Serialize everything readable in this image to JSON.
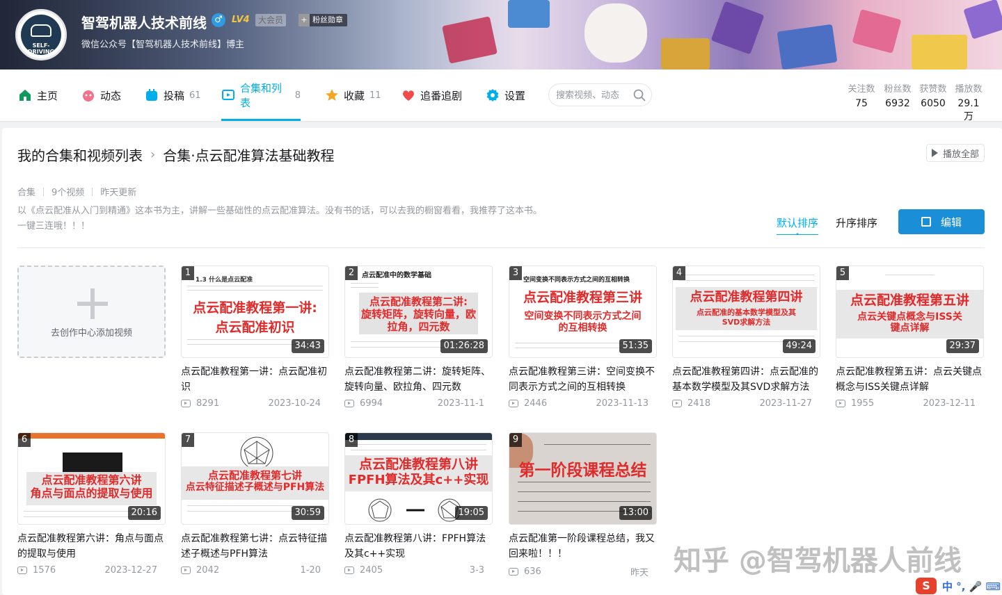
{
  "profile": {
    "name": "智驾机器人技术前线",
    "gender_symbol": "♂",
    "level": "LV4",
    "vip": "大会员",
    "fans_badge": "粉丝勋章",
    "fans_badge_plus": "+",
    "sign": "微信公众号【智驾机器人技术前线】博主",
    "avatar_text": "SELF-DRIVING ROBOT"
  },
  "nav": {
    "items": [
      {
        "label": "主页",
        "count": "",
        "icon": "home-icon",
        "color": "#0e9a5a"
      },
      {
        "label": "动态",
        "count": "",
        "icon": "dynamic-icon",
        "color": "#f2728b"
      },
      {
        "label": "投稿",
        "count": "61",
        "icon": "upload-icon",
        "color": "#00aeec"
      },
      {
        "label": "合集和列表",
        "count": "8",
        "icon": "collection-icon",
        "color": "#00aeec",
        "active": true
      },
      {
        "label": "收藏",
        "count": "11",
        "icon": "star-icon",
        "color": "#f5a623"
      },
      {
        "label": "追番追剧",
        "count": "",
        "icon": "heart-icon",
        "color": "#f04a4a"
      },
      {
        "label": "设置",
        "count": "",
        "icon": "gear-icon",
        "color": "#00aeec"
      }
    ],
    "search_placeholder": "搜索视频、动态"
  },
  "stats": [
    {
      "label": "关注数",
      "value": "75"
    },
    {
      "label": "粉丝数",
      "value": "6932"
    },
    {
      "label": "获赞数",
      "value": "6050"
    },
    {
      "label": "播放数",
      "value": "29.1万"
    }
  ],
  "collection": {
    "breadcrumb_root": "我的合集和视频列表",
    "breadcrumb_sep": "›",
    "title": "合集·点云配准算法基础教程",
    "play_all": "播放全部",
    "type": "合集",
    "video_count": "9个视频",
    "updated": "昨天更新",
    "description": "以《点云配准从入门到精通》这本书为主，讲解一些基础性的点云配准算法。没有书的话，可以去我的橱窗看看，我推荐了这本书。",
    "description2": "一键三连哦！！！",
    "sort_default": "默认排序",
    "sort_asc": "升序排序",
    "edit": "编辑",
    "add_video": "去创作中心添加视频"
  },
  "videos": [
    {
      "idx": "1",
      "thumb_text": "点云配准教程第一讲:",
      "thumb_text2": "点云配准初识",
      "thumb_head": "1.3 什么是点云配准",
      "duration": "34:43",
      "title": "点云配准教程第一讲：点云配准初识",
      "plays": "8291",
      "date": "2023-10-24"
    },
    {
      "idx": "2",
      "thumb_text": "点云配准教程第二讲:",
      "thumb_text2": "旋转矩阵，旋转向量，欧拉角，四元数",
      "thumb_head": "点云配准中的数学基础",
      "duration": "01:26:28",
      "title": "点云配准教程第二讲：旋转矩阵、旋转向量、欧拉角、四元数",
      "plays": "6994",
      "date": "2023-11-1"
    },
    {
      "idx": "3",
      "thumb_text": "点云配准教程第三讲",
      "thumb_text2": "空间变换不同表示方式之间的互相转换",
      "thumb_head": "空间变换不同表示方式之间的互相转换",
      "duration": "51:35",
      "title": "点云配准教程第三讲：空间变换不同表示方式之间的互相转换",
      "plays": "2446",
      "date": "2023-11-13"
    },
    {
      "idx": "4",
      "thumb_text": "点云配准教程第四讲",
      "thumb_text2": "点云配准的基本数学模型及其SVD求解方法",
      "thumb_head": "",
      "duration": "49:24",
      "title": "点云配准教程第四讲：点云配准的基本数学模型及其SVD求解方法",
      "plays": "2418",
      "date": "2023-11-27"
    },
    {
      "idx": "5",
      "thumb_text": "点云配准教程第五讲",
      "thumb_text2": "点云关键点概念与ISS关键点详解",
      "thumb_head": "",
      "duration": "29:37",
      "title": "点云配准教程第五讲：点云关键点概念与ISS关键点详解",
      "plays": "1955",
      "date": "2023-12-11"
    },
    {
      "idx": "6",
      "thumb_text": "点云配准教程第六讲",
      "thumb_text2": "角点与面点的提取与使用",
      "thumb_head": "",
      "duration": "20:16",
      "title": "点云配准教程第六讲：角点与面点的提取与使用",
      "plays": "1576",
      "date": "2023-12-27"
    },
    {
      "idx": "7",
      "thumb_text": "点云配准教程第七讲",
      "thumb_text2": "点云特征描述子概述与PFH算法",
      "thumb_head": "",
      "duration": "30:59",
      "title": "点云配准教程第七讲：点云特征描述子概述与PFH算法",
      "plays": "2042",
      "date": "1-20"
    },
    {
      "idx": "8",
      "thumb_text": "点云配准教程第八讲",
      "thumb_text2": "FPFH算法及其c++实现",
      "thumb_head": "",
      "duration": "19:05",
      "title": "点云配准教程第八讲：FPFH算法及其c++实现",
      "plays": "2405",
      "date": "3-3"
    },
    {
      "idx": "9",
      "thumb_text": "第一阶段课程总结",
      "thumb_text2": "",
      "thumb_head": "",
      "duration": "13:00",
      "title": "点云配准第一阶段课程总结，我又回来啦！！！",
      "plays": "636",
      "date": "昨天"
    }
  ],
  "watermark": "知乎 @智驾机器人前线",
  "ime": {
    "logo": "S",
    "label": "中 °, 🎤 ⌨"
  }
}
